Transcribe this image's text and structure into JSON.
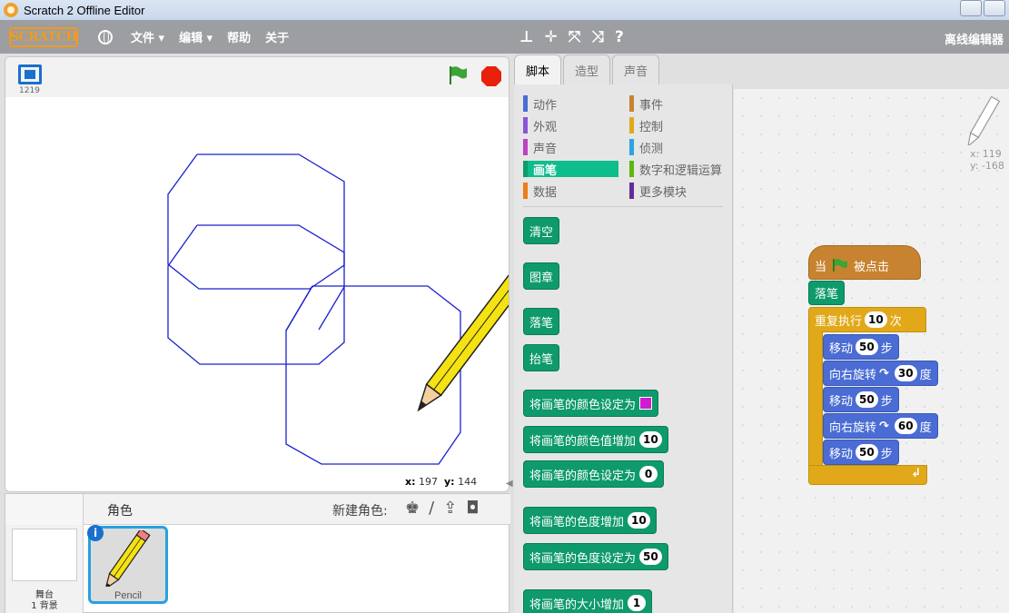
{
  "window": {
    "title": "Scratch 2 Offline Editor"
  },
  "menubar": {
    "logo": "SCRATCH",
    "items": [
      "文件 ▾",
      "编辑 ▾",
      "帮助",
      "关于"
    ],
    "tool_icons": [
      "⊥",
      "✛",
      "⤧",
      "⤨",
      "?"
    ],
    "right_label": "离线编辑器"
  },
  "stage": {
    "version": "1219",
    "coords": {
      "x_label": "x:",
      "x": "197",
      "y_label": "y:",
      "y": "144"
    }
  },
  "sprites": {
    "header_label": "角色",
    "new_sprite_label": "新建角色:",
    "stage_label": "舞台",
    "backdrop_count": "1 背景",
    "sprite_name": "Pencil"
  },
  "tabs": [
    {
      "label": "脚本",
      "active": true
    },
    {
      "label": "造型",
      "active": false
    },
    {
      "label": "声音",
      "active": false
    }
  ],
  "categories": [
    {
      "label": "动作",
      "color": "#4a6cd4"
    },
    {
      "label": "外观",
      "color": "#8a55d7"
    },
    {
      "label": "声音",
      "color": "#bb42c3"
    },
    {
      "label": "画笔",
      "color": "#0e9a6c",
      "active": true
    },
    {
      "label": "数据",
      "color": "#ee7d16"
    },
    {
      "label": "事件",
      "color": "#c88330"
    },
    {
      "label": "控制",
      "color": "#e1a91a"
    },
    {
      "label": "侦测",
      "color": "#2ca5e2"
    },
    {
      "label": "数字和逻辑运算",
      "color": "#5cb712"
    },
    {
      "label": "更多模块",
      "color": "#632d99"
    }
  ],
  "palette_blocks": {
    "clear": "清空",
    "stamp": "图章",
    "pen_down": "落笔",
    "pen_up": "抬笔",
    "set_color_to": "将画笔的颜色设定为",
    "change_color_by": "将画笔的颜色值增加",
    "change_color_by_value": "10",
    "set_color_value_to": "将画笔的颜色设定为",
    "set_color_value_to_value": "0",
    "change_shade_by": "将画笔的色度增加",
    "change_shade_by_value": "10",
    "set_shade_to": "将画笔的色度设定为",
    "set_shade_to_value": "50",
    "change_size_by": "将画笔的大小增加",
    "change_size_by_value": "1"
  },
  "script": {
    "hat_when": "当",
    "hat_clicked": "被点击",
    "pen_down": "落笔",
    "repeat_label": "重复执行",
    "repeat_count": "10",
    "repeat_suffix": "次",
    "move1_label": "移动",
    "move1_value": "50",
    "move1_suffix": "步",
    "turn1_label": "向右旋转",
    "turn1_value": "30",
    "turn1_suffix": "度",
    "move2_label": "移动",
    "move2_value": "50",
    "move2_suffix": "步",
    "turn2_label": "向右旋转",
    "turn2_value": "60",
    "turn2_suffix": "度",
    "move3_label": "移动",
    "move3_value": "50",
    "move3_suffix": "步",
    "sprite_x": "x: 119",
    "sprite_y": "y: -168"
  },
  "colors": {
    "pen_stroke": "#1a22d0",
    "pen_block": "#0e9a6c",
    "motion_block": "#4a6cd4",
    "control_block": "#e1a91a",
    "event_block": "#c88330",
    "selected_sprite_border": "#27a1de"
  }
}
